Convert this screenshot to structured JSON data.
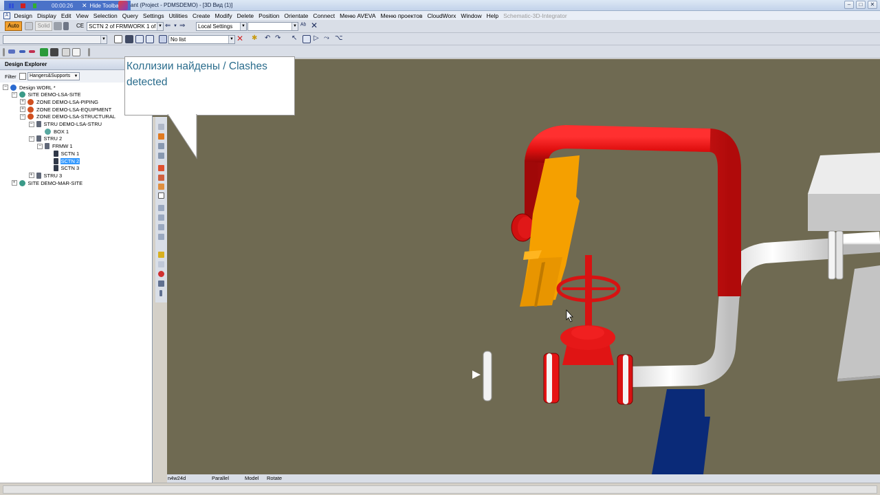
{
  "recorder": {
    "time": "00:00:26",
    "hide_toolbar": "Hide Toolbar",
    "close_glyph": "✕"
  },
  "window": {
    "title": "ant (Project - PDMSDEMO) - [3D Вид (1)]",
    "min": "–",
    "max": "□",
    "close": "✕"
  },
  "menu": {
    "app_icon": "A",
    "items": [
      "Design",
      "Display",
      "Edit",
      "View",
      "Selection",
      "Query",
      "Settings",
      "Utilities",
      "Create",
      "Modify",
      "Delete",
      "Position",
      "Orientate",
      "Connect",
      "Меню AVEVA",
      "Меню проектов",
      "CloudWorx",
      "Window",
      "Help"
    ],
    "disabled_item": "Schematic-3D-Integrator"
  },
  "toolbar1": {
    "auto": "Auto",
    "solid": "Solid",
    "ce_label": "CE",
    "ce_value": "SCTN 2 of FRMWORK 1 of S'",
    "settings_value": "Local Settings",
    "empty_combo": ""
  },
  "toolbar2": {
    "list_value": "No list"
  },
  "explorer": {
    "title": "Design Explorer",
    "filter_label": "Filter",
    "filter_value": "Hangers&Supports",
    "tree": [
      {
        "label": "Design WORL *",
        "level": 0,
        "expander": "−",
        "icon": "globe"
      },
      {
        "label": "SITE DEMO-LSA-SITE",
        "level": 1,
        "expander": "−",
        "icon": "site"
      },
      {
        "label": "ZONE DEMO-LSA-PIPING",
        "level": 2,
        "expander": "+",
        "icon": "zone"
      },
      {
        "label": "ZONE DEMO-LSA-EQUIPMENT",
        "level": 2,
        "expander": "+",
        "icon": "zone"
      },
      {
        "label": "ZONE DEMO-LSA-STRUCTURAL",
        "level": 2,
        "expander": "−",
        "icon": "zone"
      },
      {
        "label": "STRU DEMO-LSA-STRU",
        "level": 3,
        "expander": "−",
        "icon": "stru"
      },
      {
        "label": "BOX 1",
        "level": 4,
        "expander": "",
        "icon": "box"
      },
      {
        "label": "STRU 2",
        "level": 3,
        "expander": "−",
        "icon": "stru"
      },
      {
        "label": "FRMW 1",
        "level": 4,
        "expander": "−",
        "icon": "frmw"
      },
      {
        "label": "SCTN 1",
        "level": 5,
        "expander": "",
        "icon": "sctn"
      },
      {
        "label": "SCTN 2",
        "level": 5,
        "expander": "",
        "icon": "sctn",
        "selected": true
      },
      {
        "label": "SCTN 3",
        "level": 5,
        "expander": "",
        "icon": "sctn"
      },
      {
        "label": "STRU 3",
        "level": 3,
        "expander": "+",
        "icon": "stru"
      },
      {
        "label": "SITE DEMO-MAR-SITE",
        "level": 1,
        "expander": "+",
        "icon": "site"
      }
    ]
  },
  "callout": {
    "text": "Коллизии найдены / Clashes detected"
  },
  "status": {
    "coords": "n4w24d",
    "projection": "Parallel",
    "mode": "Model",
    "action": "Rotate"
  },
  "colors": {
    "viewport_bg": "#6f6a52",
    "pipe_red": "#e01515",
    "pipe_white": "#f2f2f2",
    "steel_orange": "#f5a000",
    "column_blue": "#0a2a78",
    "selection": "#3399ff"
  }
}
